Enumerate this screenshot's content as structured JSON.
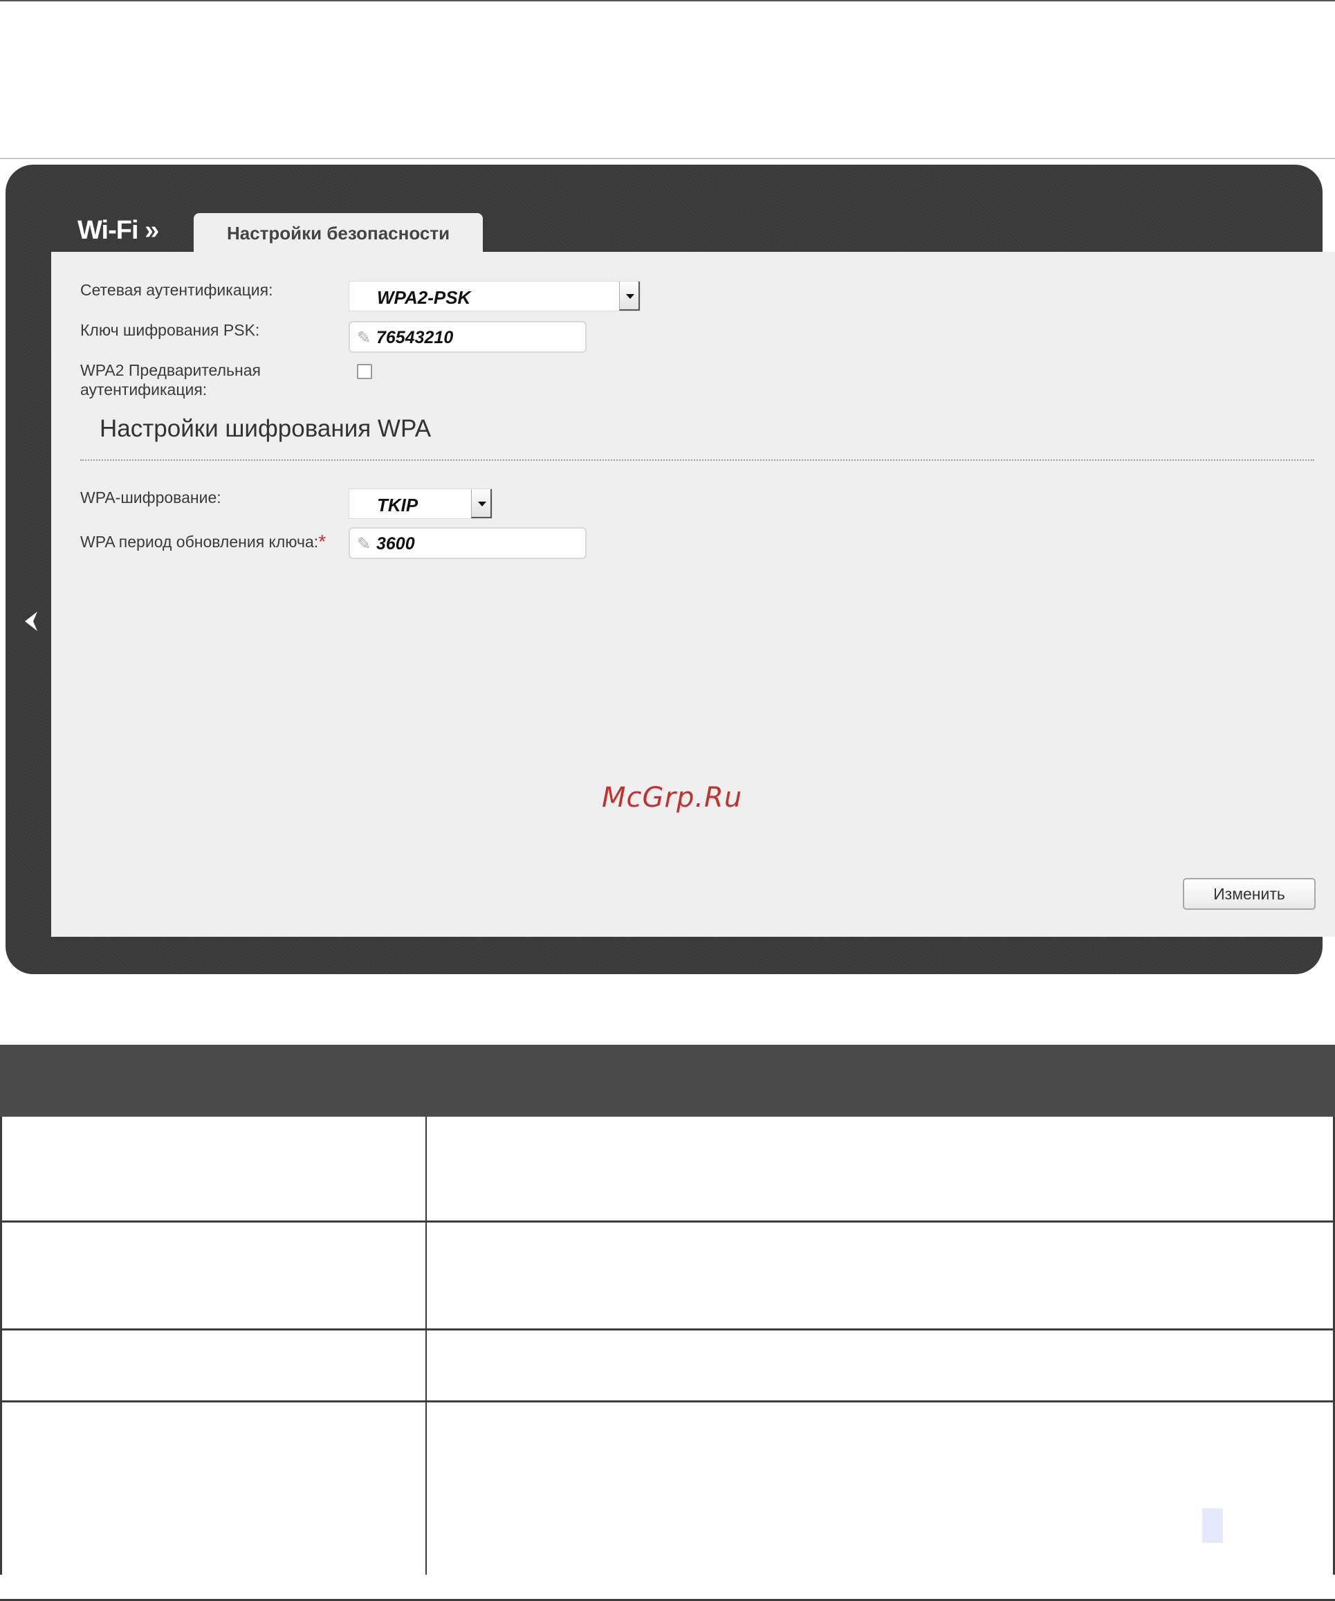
{
  "router_ui": {
    "section_title": "Wi-Fi »",
    "tab_label": "Настройки безопасности",
    "back_arrow_icon": "chevron-left-icon",
    "fields": {
      "auth_label": "Сетевая аутентификация:",
      "auth_value": "WPA2-PSK",
      "psk_label": "Ключ шифрования PSK:",
      "psk_value": "76543210",
      "preauth_label_line1": "WPA2 Предварительная",
      "preauth_label_line2": "аутентификация:",
      "preauth_checked": false
    },
    "wpa_section": {
      "heading": "Настройки шифрования WPA",
      "encryption_label": "WPA-шифрование:",
      "encryption_value": "TKIP",
      "rekey_label": "WPA период обновления ключа:",
      "required_mark": "*",
      "rekey_value": "3600"
    },
    "change_button": "Изменить"
  },
  "watermark": "McGrp.Ru",
  "colors": {
    "frame_dark": "#3a3a3a",
    "content_bg": "#efefef",
    "required": "#e22222",
    "watermark": "#c0332f",
    "table_header": "#4b4b4b"
  }
}
